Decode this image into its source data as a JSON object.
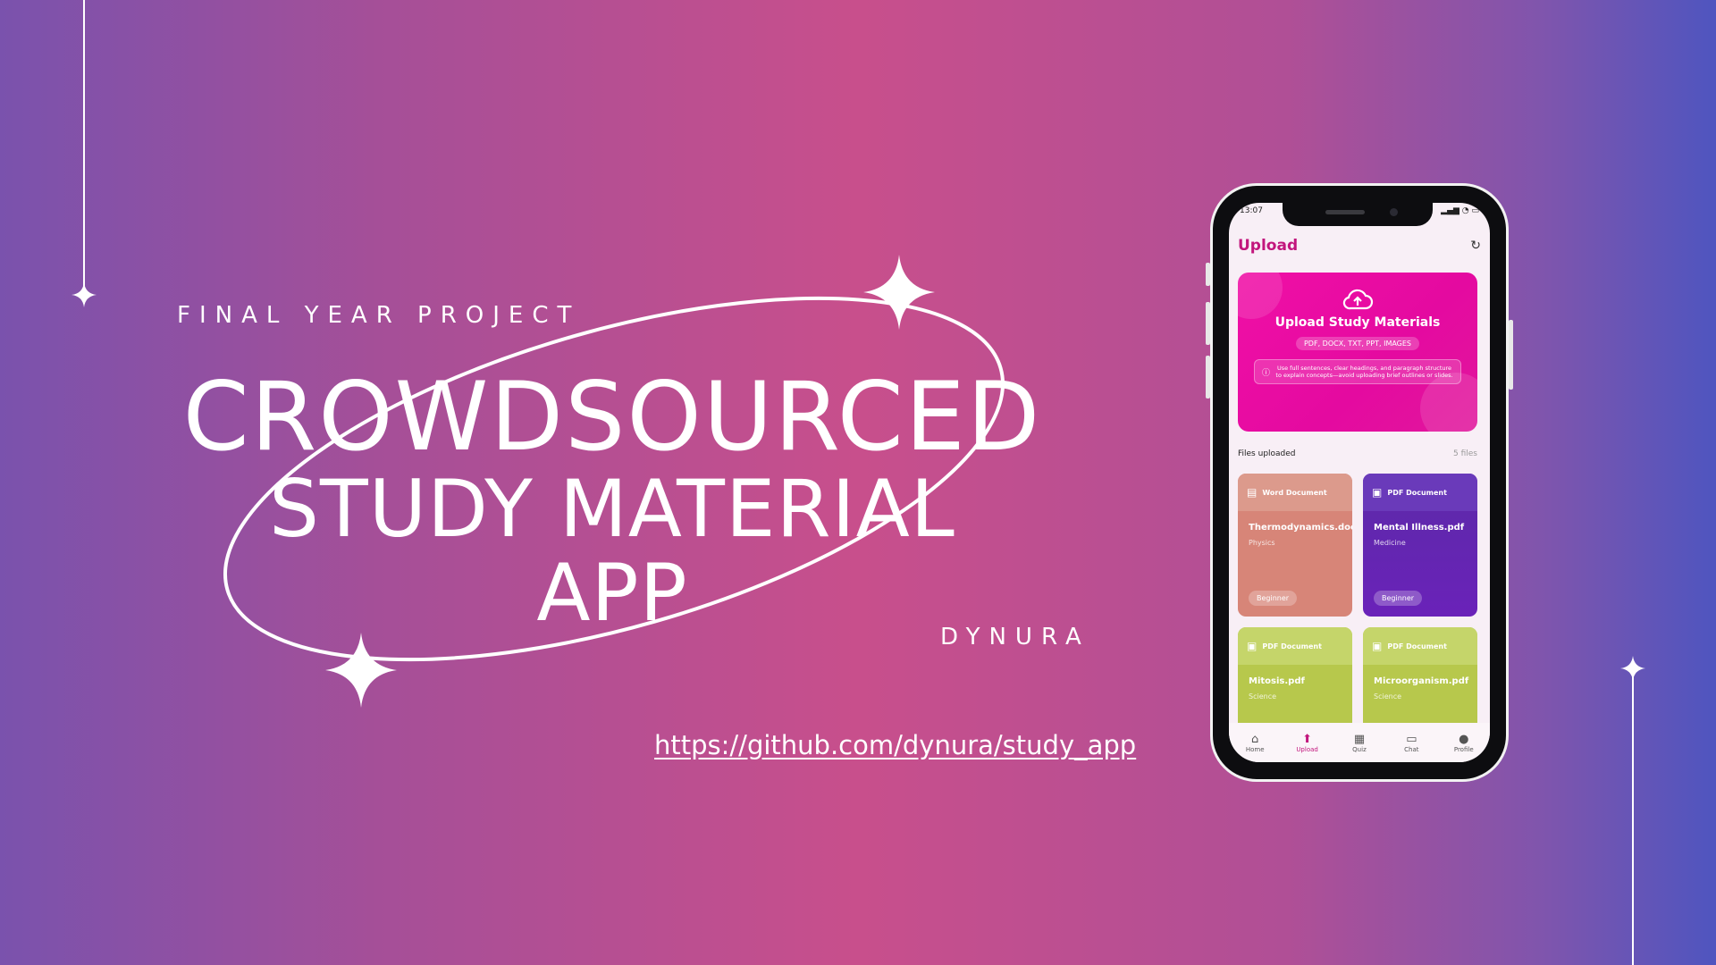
{
  "slide": {
    "kicker": "FINAL YEAR PROJECT",
    "title_line1": "CROWDSOURCED",
    "title_line2": "STUDY MATERIAL",
    "title_line3": "APP",
    "author": "DYNURA",
    "repo_url": "https://github.com/dynura/study_app"
  },
  "phone": {
    "status_time": "13:07",
    "header_title": "Upload",
    "hero": {
      "title": "Upload Study Materials",
      "file_types": "PDF, DOCX, TXT, PPT, IMAGES",
      "tip": "Use full sentences, clear headings, and paragraph structure to explain concepts—avoid uploading brief outlines or slides."
    },
    "files_label": "Files uploaded",
    "files_count": "5 files",
    "cards": [
      {
        "type": "Word Document",
        "name": "Thermodynamics.docx",
        "subject": "Physics",
        "level": "Beginner"
      },
      {
        "type": "PDF Document",
        "name": "Mental Illness.pdf",
        "subject": "Medicine",
        "level": "Beginner"
      },
      {
        "type": "PDF Document",
        "name": "Mitosis.pdf",
        "subject": "Science"
      },
      {
        "type": "PDF Document",
        "name": "Microorganism.pdf",
        "subject": "Science"
      }
    ],
    "nav": [
      {
        "label": "Home",
        "icon": "home-icon"
      },
      {
        "label": "Upload",
        "icon": "upload-icon"
      },
      {
        "label": "Quiz",
        "icon": "quiz-icon"
      },
      {
        "label": "Chat",
        "icon": "chat-icon"
      },
      {
        "label": "Profile",
        "icon": "profile-icon"
      }
    ]
  },
  "colors": {
    "accent": "#c2167d",
    "hero_pink": "#e40aa0",
    "card_word": "#d78578",
    "card_pdf_purple": "#5c2aa8",
    "card_pdf_green": "#b7c84c"
  }
}
